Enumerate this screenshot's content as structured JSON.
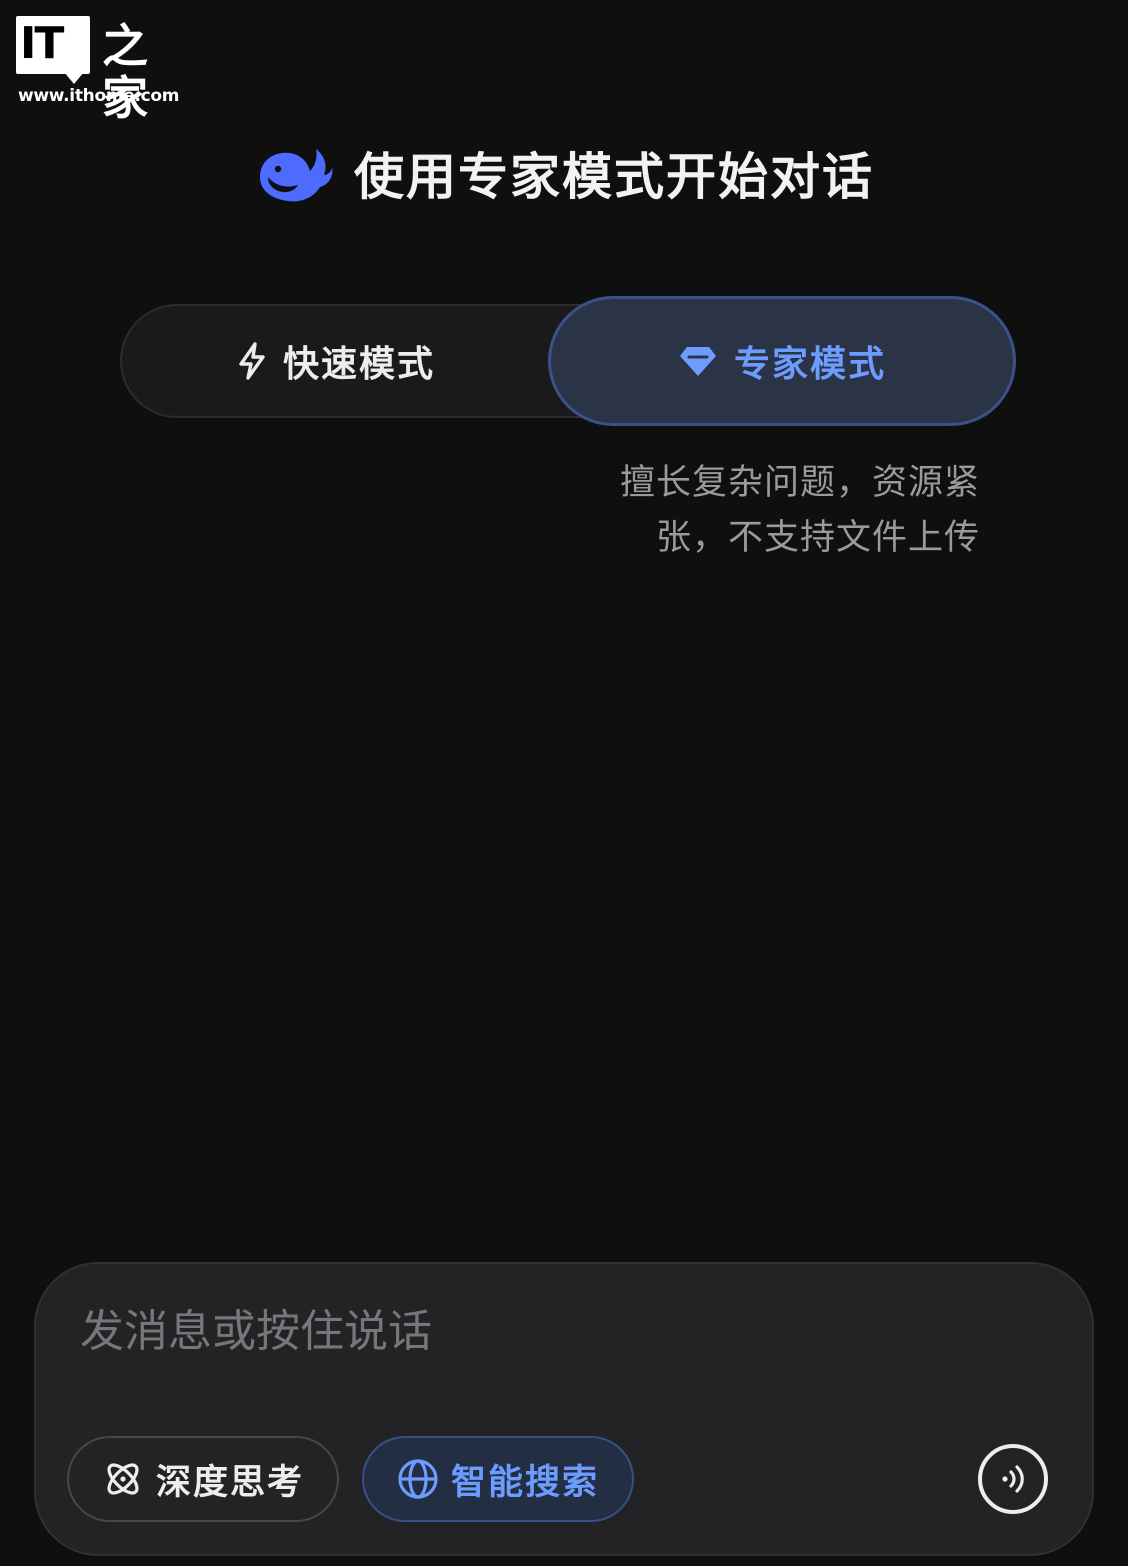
{
  "watermark": {
    "badge": "IT",
    "hanzi": "之家",
    "url": "www.ithome.com"
  },
  "header": {
    "logo_icon": "whale-icon",
    "title": "使用专家模式开始对话"
  },
  "modes": {
    "fast": {
      "label": "快速模式",
      "icon": "lightning-icon",
      "selected": false
    },
    "expert": {
      "label": "专家模式",
      "icon": "diamond-icon",
      "selected": true
    },
    "description_lines": [
      "擅长复杂问题，资源紧",
      "张，不支持文件上传"
    ]
  },
  "composer": {
    "placeholder": "发消息或按住说话",
    "value": "",
    "chips": {
      "deep_think": {
        "label": "深度思考",
        "icon": "atom-icon",
        "active": false
      },
      "smart_search": {
        "label": "智能搜索",
        "icon": "globe-icon",
        "active": true
      }
    },
    "voice_icon": "voice-wave-icon"
  },
  "colors": {
    "background": "#0f0f10",
    "accent": "#6d9cff",
    "brand_blue": "#4d6bfe",
    "text_primary": "#ededed",
    "text_secondary": "#9a9a9e",
    "selected_bg": "#2a3446"
  }
}
